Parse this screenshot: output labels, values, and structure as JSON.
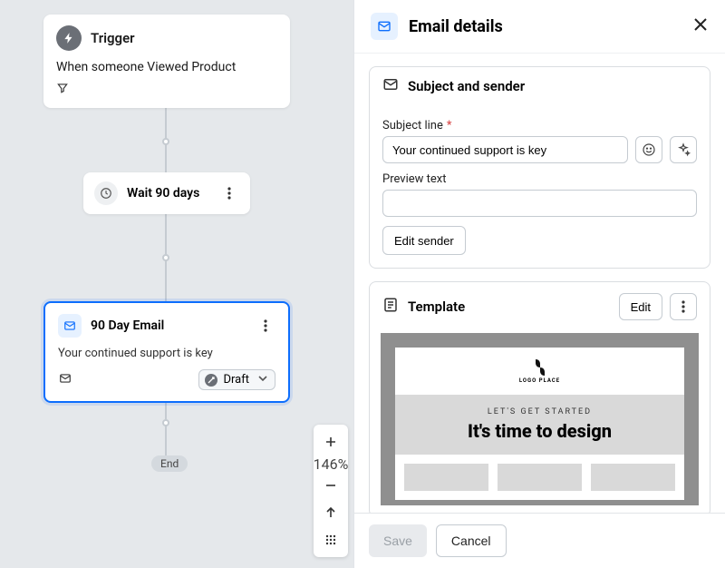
{
  "canvas": {
    "trigger": {
      "title": "Trigger",
      "description": "When someone Viewed Product"
    },
    "wait": {
      "label": "Wait 90 days"
    },
    "email": {
      "title": "90 Day Email",
      "description": "Your continued support is key",
      "status": "Draft"
    },
    "end_label": "End",
    "controls": {
      "zoom": "146%"
    }
  },
  "panel": {
    "title": "Email details",
    "subject_section": {
      "title": "Subject and sender",
      "subject_label": "Subject line",
      "subject_value": "Your continued support is key",
      "preview_label": "Preview text",
      "preview_value": "",
      "edit_sender_label": "Edit sender"
    },
    "template_section": {
      "title": "Template",
      "edit_label": "Edit",
      "preview": {
        "logo_text": "LOGO PLACE",
        "kicker": "LET'S GET STARTED",
        "headline": "It's time to design"
      }
    },
    "footer": {
      "save": "Save",
      "cancel": "Cancel"
    }
  }
}
